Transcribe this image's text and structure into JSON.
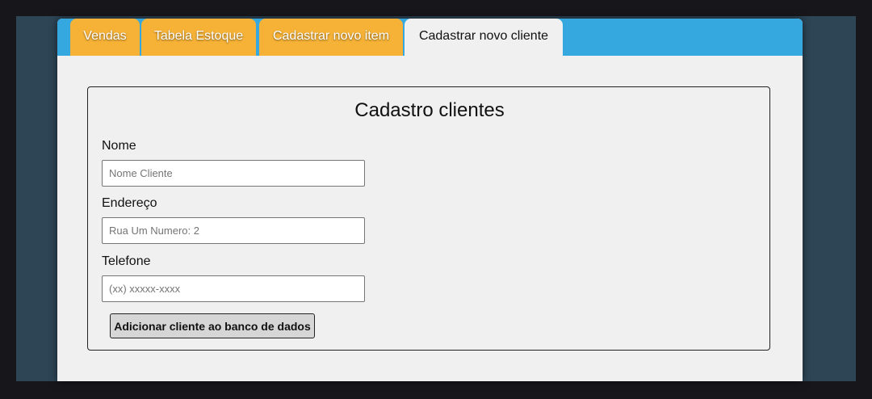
{
  "tabs": [
    {
      "label": "Vendas",
      "active": false
    },
    {
      "label": "Tabela Estoque",
      "active": false
    },
    {
      "label": "Cadastrar novo item",
      "active": false
    },
    {
      "label": "Cadastrar novo cliente",
      "active": true
    }
  ],
  "form": {
    "title": "Cadastro clientes",
    "fields": [
      {
        "label": "Nome",
        "placeholder": "Nome Cliente",
        "value": ""
      },
      {
        "label": "Endereço",
        "placeholder": "Rua Um Numero: 2",
        "value": ""
      },
      {
        "label": "Telefone",
        "placeholder": "(xx) xxxxx-xxxx",
        "value": ""
      }
    ],
    "submit_label": "Adicionar cliente ao banco de dados"
  },
  "colors": {
    "tabbar": "#35a8e0",
    "tab_inactive": "#f6b237",
    "content_background": "#f0f0f0",
    "page_background": "#2d4555"
  }
}
